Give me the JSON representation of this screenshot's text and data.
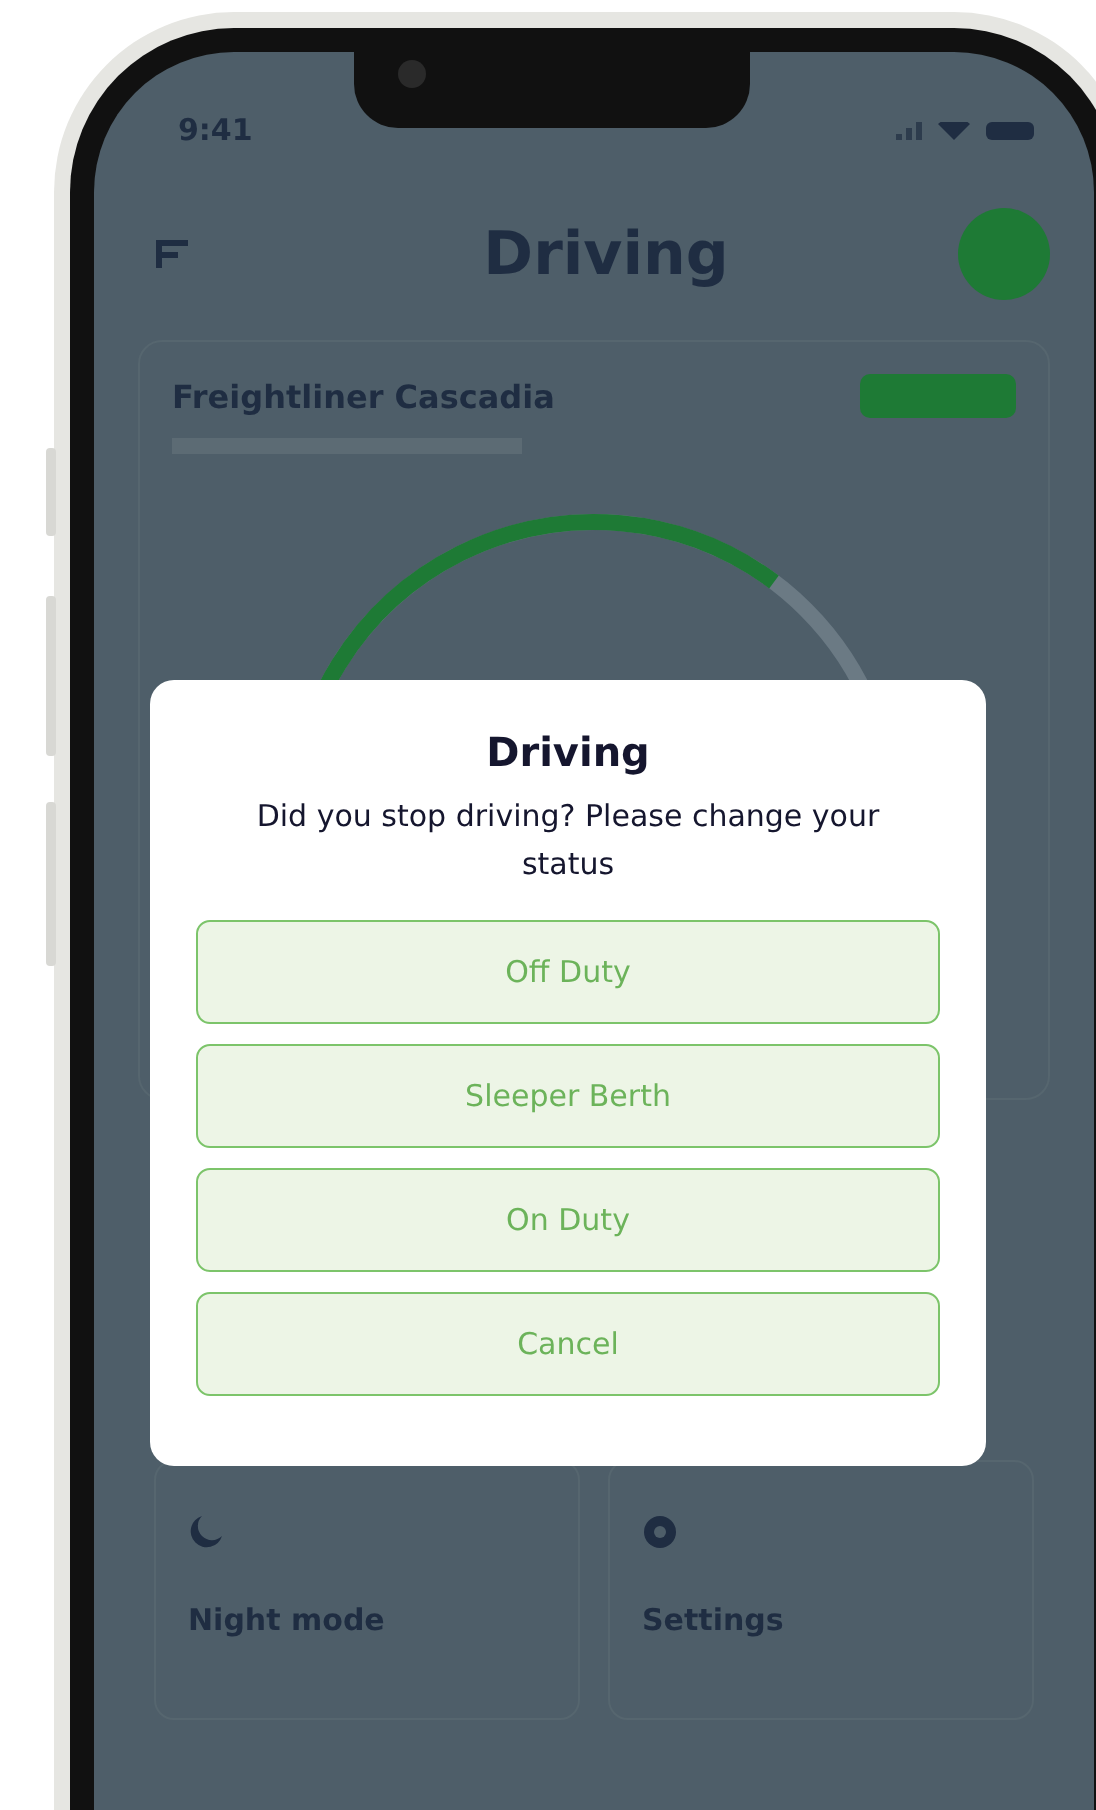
{
  "status_bar": {
    "time": "9:41"
  },
  "header": {
    "title": "Driving"
  },
  "vehicle_card": {
    "name": "Freightliner Cascadia"
  },
  "tiles": [
    {
      "kind": "night",
      "label": "Night mode"
    },
    {
      "kind": "settings",
      "label": "Settings"
    }
  ],
  "dialog": {
    "title": "Driving",
    "message": "Did you stop driving? Please change your status",
    "buttons": [
      "Off Duty",
      "Sleeper Berth",
      "On Duty",
      "Cancel"
    ]
  }
}
